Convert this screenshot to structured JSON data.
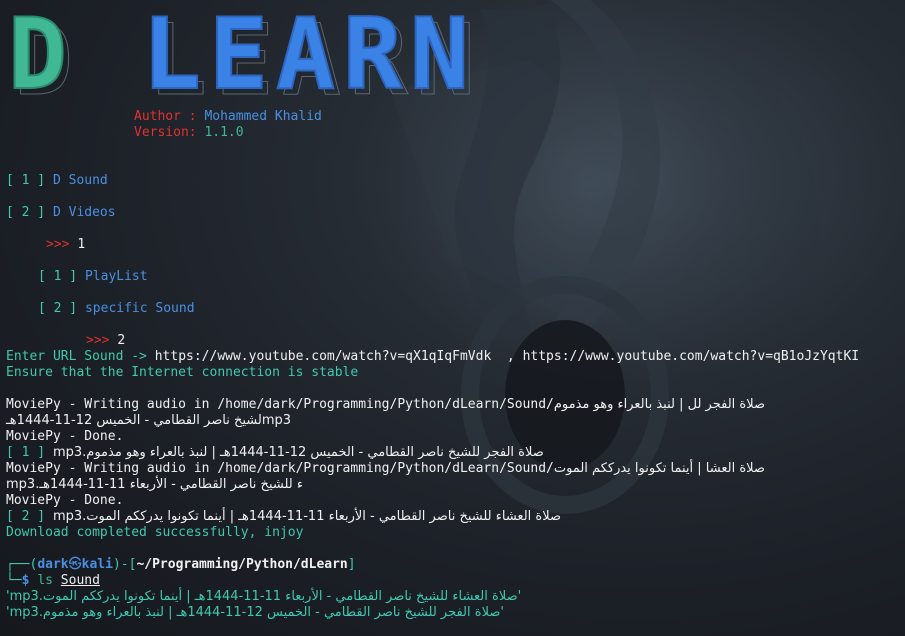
{
  "logo": {
    "d": "D",
    "learn": "LEARN"
  },
  "author": {
    "label": "Author : ",
    "name": "Mohammed Khalid",
    "version_label": "Version: ",
    "version": "1.1.0"
  },
  "menu": {
    "opt1_bracket": "[ 1 ]",
    "opt1_label": "D Sound",
    "opt2_bracket": "[ 2 ]",
    "opt2_label": "D Videos",
    "prompt1": ">>>",
    "answer1": "1",
    "sub1_bracket": "[ 1 ]",
    "sub1_label": "PlayList",
    "sub2_bracket": "[ 2 ]",
    "sub2_label": "specific Sound",
    "prompt2": ">>>",
    "answer2": "2"
  },
  "output": {
    "enter_url_label": "Enter URL Sound -> ",
    "enter_url_value": "https://www.youtube.com/watch?v=qX1qIqFmVdk  , https://www.youtube.com/watch?v=qB1oJzYqtKI",
    "ensure": "Ensure that the Internet connection is stable",
    "writing1_a": "MoviePy - Writing audio in /home/dark/Programming/Python/dLearn/Sound/",
    "writing1_b": "صلاة الفجر لل | لنبذ بالعراء وهو مذموم",
    "writing1_c": "mp3لشيخ ناصر القطامي - الخميس 12-11-1444هـ",
    "done1": "MoviePy - Done.",
    "item1_bracket": "[ 1 ]",
    "item1_text": "صلاة الفجر للشيخ ناصر القطامي - الخميس 12-11-1444هـ | لنبذ بالعراء وهو مذموم.mp3",
    "writing2_a": "MoviePy - Writing audio in /home/dark/Programming/Python/dLearn/Sound/",
    "writing2_b": "صلاة العشا | أينما تكونوا يدرككم الموت",
    "writing2_c": "ء للشيخ ناصر القطامي - الأربعاء 11-11-1444هـ.mp3",
    "done2": "MoviePy - Done.",
    "item2_bracket": "[ 2 ]",
    "item2_text": "صلاة العشاء للشيخ ناصر القطامي - الأربعاء 11-11-1444هـ | أينما تكونوا يدرككم الموت.mp3",
    "download_done": "Download completed successfully, injoy"
  },
  "prompt": {
    "corner_top": "┌──(",
    "user": "dark",
    "at": "㉿",
    "host": "kali",
    "sep": ")-[",
    "path": "~/Programming/Python/dLearn",
    "close": "]",
    "corner_bottom": "└─",
    "dollar": "$",
    "cmd": "ls",
    "arg": "Sound"
  },
  "listing": {
    "file1": "'صلاة العشاء للشيخ ناصر القطامي - الأربعاء 11-11-1444هـ | أينما تكونوا يدرككم الموت.mp3'",
    "file2": "'صلاة الفجر للشيخ ناصر القطامي - الخميس 12-11-1444هـ | لنبذ بالعراء وهو مذموم.mp3'"
  },
  "colors": {
    "logo_d": "#3fb893",
    "logo_learn": "#3b82e6",
    "red": "#e0322f",
    "blue": "#4a90e2",
    "cyan": "#40c8b0"
  }
}
